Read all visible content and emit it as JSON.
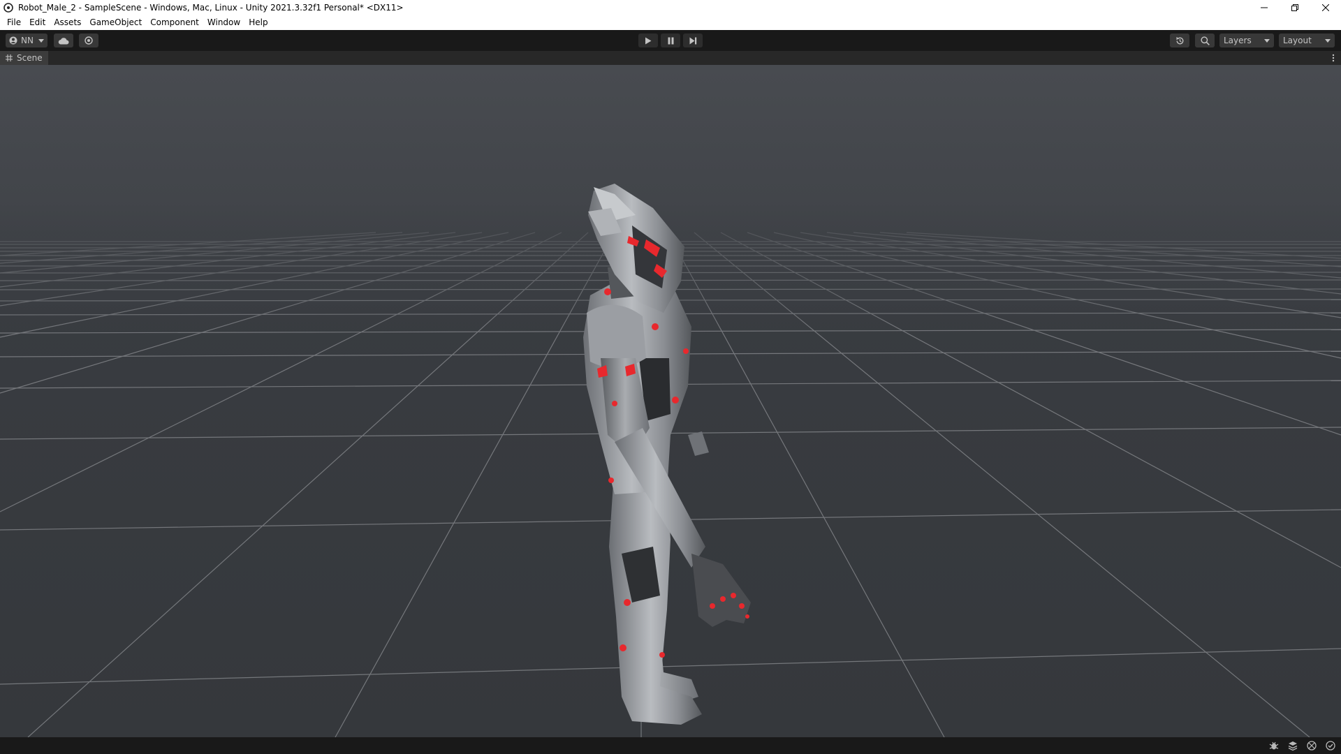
{
  "window": {
    "title": "Robot_Male_2 - SampleScene - Windows, Mac, Linux - Unity 2021.3.32f1 Personal* <DX11>"
  },
  "menu": [
    "File",
    "Edit",
    "Assets",
    "GameObject",
    "Component",
    "Window",
    "Help"
  ],
  "toolbar": {
    "account_label": "NN",
    "layers_label": "Layers",
    "layout_label": "Layout"
  },
  "scene_tab": {
    "label": "Scene"
  },
  "colors": {
    "accent_red": "#e8282d",
    "robot_silver": "#a6a9ad",
    "grid_line": "#8a8c90"
  }
}
